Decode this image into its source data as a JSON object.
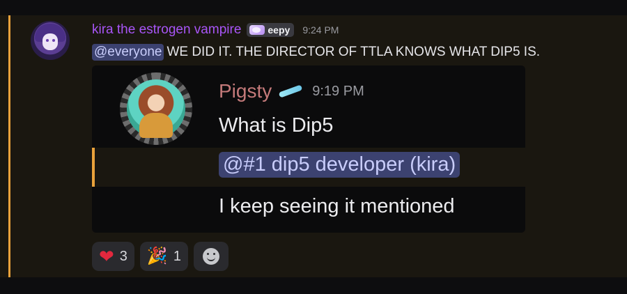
{
  "message": {
    "username": "kira the estrogen vampire",
    "tag": "eepy",
    "timestamp": "9:24 PM",
    "mention": "@everyone",
    "text": "WE DID IT. THE DIRECTOR OF TTLA KNOWS WHAT DIP5 IS."
  },
  "quoted": {
    "username": "Pigsty",
    "timestamp": "9:19 PM",
    "line1": "What is Dip5",
    "mention": "@#1 dip5 developer (kira)",
    "line2": "I keep seeing it mentioned"
  },
  "reactions": [
    {
      "icon": "heart-icon",
      "emoji": "❤",
      "count": "3"
    },
    {
      "icon": "party-popper-icon",
      "emoji": "🎉",
      "count": "1"
    }
  ],
  "colors": {
    "accent": "#e9a23b",
    "username": "#a855f7",
    "mention_bg": "#3c4270",
    "mention_text": "#c9cdfb"
  }
}
